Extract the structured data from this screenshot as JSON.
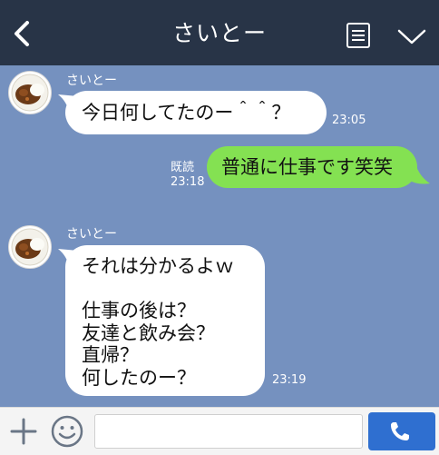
{
  "header": {
    "title": "さいとー",
    "back_icon": "chevron-left-icon",
    "menu_icon": "note-list-icon",
    "dropdown_icon": "chevron-down-icon"
  },
  "messages": [
    {
      "side": "left",
      "sender": "さいとー",
      "text": "今日何してたのー＾＾？",
      "time": "23:05"
    },
    {
      "side": "right",
      "read": "既読",
      "text": "普通に仕事です笑笑",
      "time": "23:18"
    },
    {
      "side": "left",
      "sender": "さいとー",
      "lines": [
        "それは分かるよｗ",
        "",
        "仕事の後は？",
        "友達と飲み会？",
        "直帰？",
        "何したのー？"
      ],
      "time": "23:19"
    }
  ],
  "footer": {
    "plus_icon": "plus-icon",
    "emoji_icon": "smiley-icon",
    "input_value": "",
    "call_icon": "phone-icon"
  },
  "colors": {
    "header_bg": "#283447",
    "chat_bg": "#7591bf",
    "sent_bubble": "#84e152",
    "received_bubble": "#ffffff",
    "call_button": "#2f6fd0"
  }
}
